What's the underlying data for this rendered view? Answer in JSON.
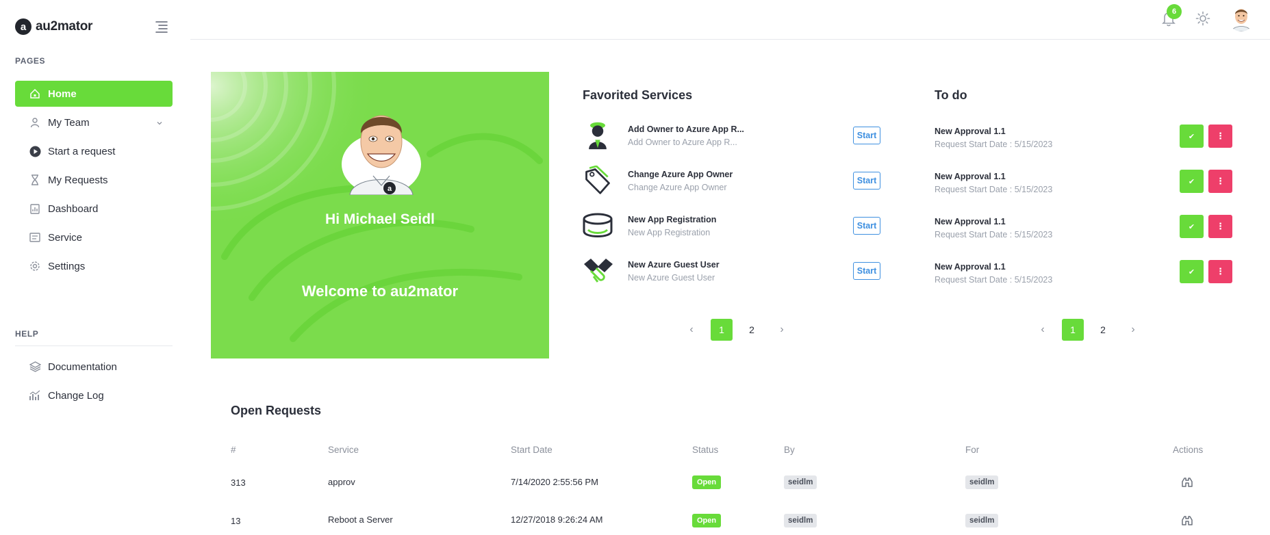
{
  "brand": {
    "mark": "a",
    "name": "au2mator"
  },
  "sidebar": {
    "pages_label": "PAGES",
    "items": [
      {
        "label": "Home",
        "icon": "home-icon"
      },
      {
        "label": "My Team",
        "icon": "user-icon"
      },
      {
        "label": "Start a request",
        "icon": "play-icon"
      },
      {
        "label": "My Requests",
        "icon": "hourglass-icon"
      },
      {
        "label": "Dashboard",
        "icon": "clipboard-chart-icon"
      },
      {
        "label": "Service",
        "icon": "list-icon"
      },
      {
        "label": "Settings",
        "icon": "gear-icon"
      }
    ],
    "help_label": "HELP",
    "help_items": [
      {
        "label": "Documentation",
        "icon": "layers-icon"
      },
      {
        "label": "Change Log",
        "icon": "chart-icon"
      }
    ]
  },
  "header": {
    "notification_count": "6"
  },
  "hero": {
    "greeting": "Hi Michael Seidl",
    "welcome": "Welcome to au2mator"
  },
  "favorites": {
    "title": "Favorited Services",
    "start_label": "Start",
    "items": [
      {
        "name": "Add Owner to Azure App R...",
        "sub": "Add Owner to Azure App R..."
      },
      {
        "name": "Change Azure App Owner",
        "sub": "Change Azure App Owner"
      },
      {
        "name": "New App Registration",
        "sub": "New App Registration"
      },
      {
        "name": "New Azure Guest User",
        "sub": "New Azure Guest User"
      }
    ],
    "pages": [
      "1",
      "2"
    ]
  },
  "todo": {
    "title": "To do",
    "items": [
      {
        "name": "New Approval 1.1",
        "sub": "Request Start Date : 5/15/2023"
      },
      {
        "name": "New Approval 1.1",
        "sub": "Request Start Date : 5/15/2023"
      },
      {
        "name": "New Approval 1.1",
        "sub": "Request Start Date : 5/15/2023"
      },
      {
        "name": "New Approval 1.1",
        "sub": "Request Start Date : 5/15/2023"
      }
    ],
    "pages": [
      "1",
      "2"
    ]
  },
  "requests": {
    "title": "Open Requests",
    "columns": [
      "#",
      "Service",
      "Start Date",
      "Status",
      "By",
      "For",
      "Actions"
    ],
    "rows": [
      {
        "id": "313",
        "service": "approv",
        "start": "7/14/2020 2:55:56 PM",
        "status": "Open",
        "by": "seidlm",
        "for": "seidlm"
      },
      {
        "id": "13",
        "service": "Reboot a Server",
        "start": "12/27/2018 9:26:24 AM",
        "status": "Open",
        "by": "seidlm",
        "for": "seidlm"
      }
    ]
  },
  "colors": {
    "accent": "#68db3a",
    "danger": "#ee3f6a",
    "link": "#3d8fe0"
  }
}
